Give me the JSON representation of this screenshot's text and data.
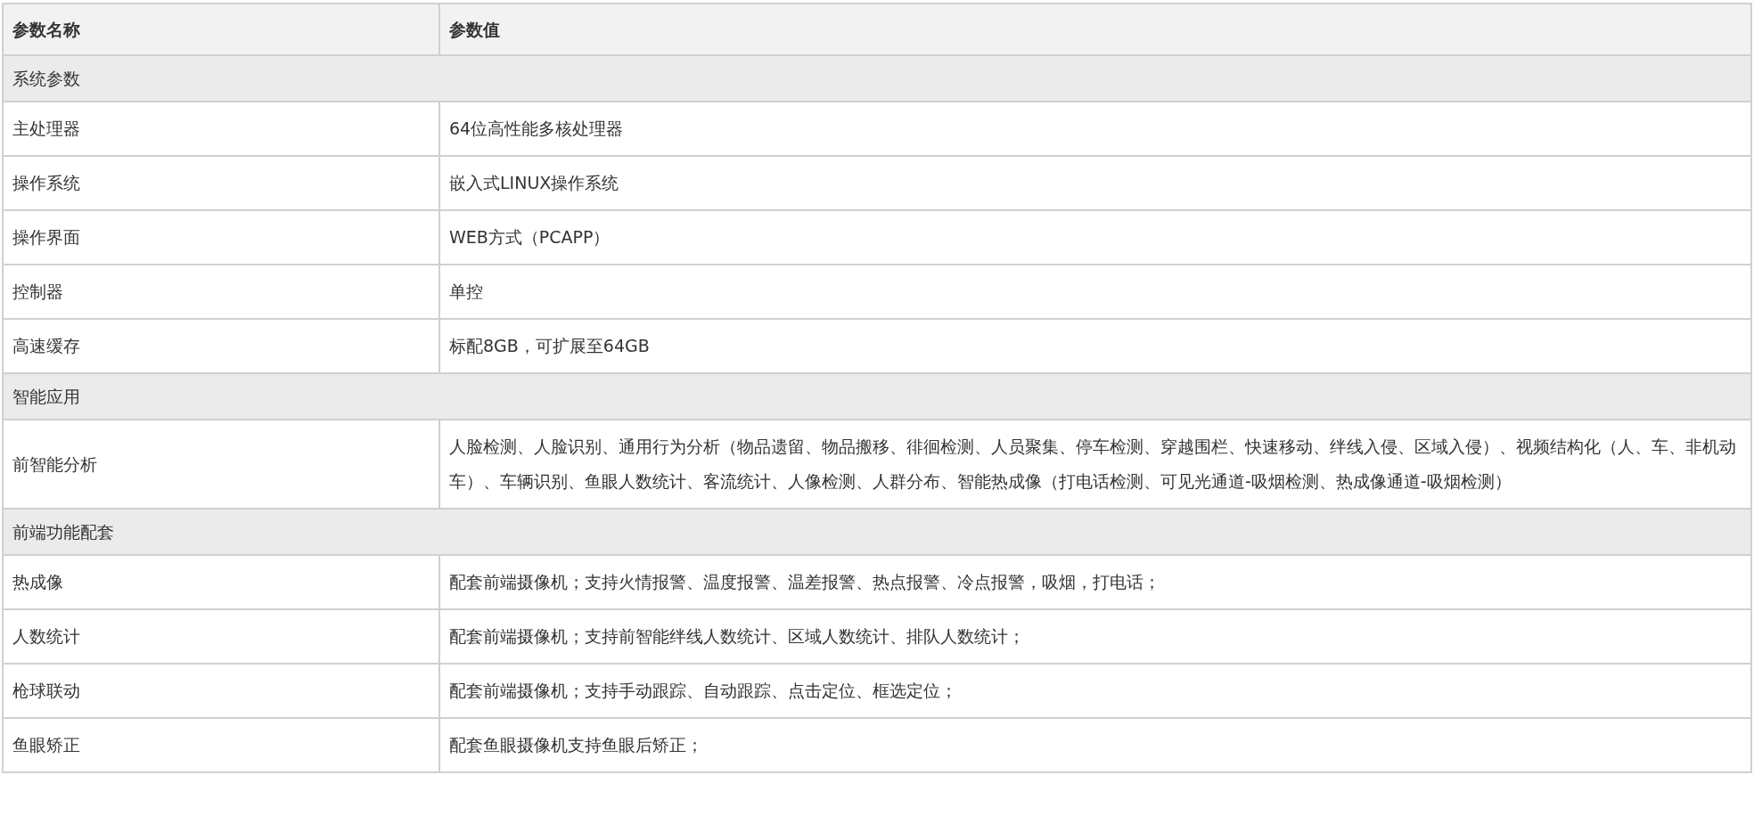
{
  "table": {
    "columns": [
      "参数名称",
      "参数值"
    ],
    "groups": [
      {
        "title": "系统参数",
        "rows": [
          {
            "name": "主处理器",
            "value": "64位高性能多核处理器"
          },
          {
            "name": "操作系统",
            "value": "嵌入式LINUX操作系统"
          },
          {
            "name": "操作界面",
            "value": "WEB方式（PCAPP）"
          },
          {
            "name": "控制器",
            "value": "单控"
          },
          {
            "name": "高速缓存",
            "value": "标配8GB，可扩展至64GB"
          }
        ]
      },
      {
        "title": "智能应用",
        "rows": [
          {
            "name": "前智能分析",
            "value": "人脸检测、人脸识别、通用行为分析（物品遗留、物品搬移、徘徊检测、人员聚集、停车检测、穿越围栏、快速移动、绊线入侵、区域入侵）、视频结构化（人、车、非机动车）、车辆识别、鱼眼人数统计、客流统计、人像检测、人群分布、智能热成像（打电话检测、可见光通道-吸烟检测、热成像通道-吸烟检测）"
          }
        ]
      },
      {
        "title": "前端功能配套",
        "rows": [
          {
            "name": "热成像",
            "value": "配套前端摄像机；支持火情报警、温度报警、温差报警、热点报警、冷点报警，吸烟，打电话；"
          },
          {
            "name": "人数统计",
            "value": "配套前端摄像机；支持前智能绊线人数统计、区域人数统计、排队人数统计；"
          },
          {
            "name": "枪球联动",
            "value": "配套前端摄像机；支持手动跟踪、自动跟踪、点击定位、框选定位；"
          },
          {
            "name": "鱼眼矫正",
            "value": "配套鱼眼摄像机支持鱼眼后矫正；"
          }
        ]
      }
    ]
  }
}
